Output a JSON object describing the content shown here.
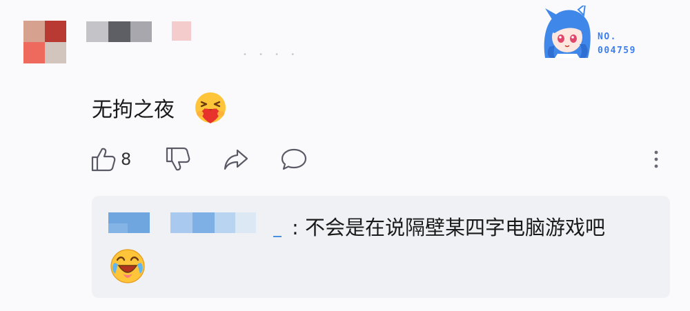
{
  "comment": {
    "text": "无拘之夜",
    "emoji": "hugging-heart-emoji"
  },
  "badge": {
    "number_label": "NO.",
    "number_value": "004759"
  },
  "actions": {
    "like_count": "8",
    "icons": [
      "thumbs-up-icon",
      "thumbs-down-icon",
      "share-icon",
      "comment-icon",
      "more-icon"
    ]
  },
  "reply": {
    "separator": ":",
    "text": "不会是在说隔壁某四字电脑游戏吧",
    "emoji": "laughing-cry-emoji"
  },
  "colors": {
    "accent_blue": "#3a7ef0",
    "reply_bg": "#eff1f5",
    "icon_gray": "#5a5a66"
  }
}
